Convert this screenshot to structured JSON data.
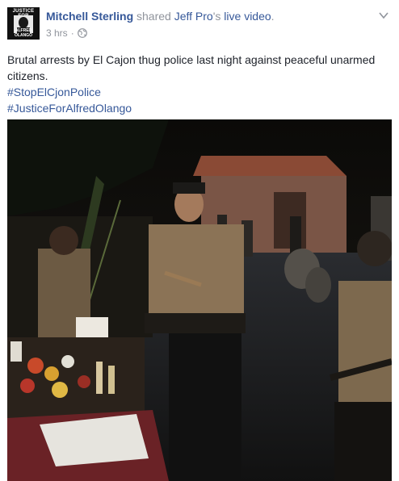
{
  "post": {
    "author": "Mitchell Sterling",
    "action": "shared",
    "shared_from": "Jeff Pro",
    "possessive": "'s",
    "object": "live video",
    "period": ".",
    "time": "3 hrs",
    "separator": "·",
    "audience_icon": "globe-icon",
    "menu_icon": "chevron-down-icon",
    "text": "Brutal arrests by El Cajon thug police last night against peaceful unarmed citizens.",
    "hashtags": [
      "#StopElCjonPolice",
      "#JusticeForAlfredOlango"
    ]
  },
  "avatar": {
    "caption_top": "JUSTICE FOR",
    "caption_bottom": "ALFRED OLANGO"
  },
  "video": {
    "scene": "night-protest-police"
  },
  "colors": {
    "link": "#365899",
    "meta": "#90949c",
    "text": "#1d2129"
  }
}
